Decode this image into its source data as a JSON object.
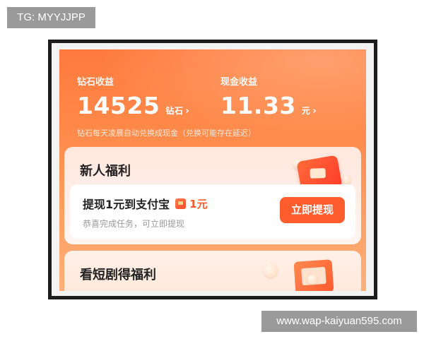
{
  "watermarks": {
    "top_left": "TG: MYYJJPP",
    "bottom_right": "www.wap-kaiyuan595.com"
  },
  "earnings": {
    "diamond": {
      "label": "钻石收益",
      "value": "14525",
      "unit": "钻石",
      "chevron": "›"
    },
    "cash": {
      "label": "现金收益",
      "value": "11.33",
      "unit": "元",
      "chevron": "›"
    },
    "note": "钻石每天凌晨自动兑换成现金（兑换可能存在延迟）"
  },
  "new_user_card": {
    "title": "新人福利",
    "task": {
      "title": "提现1元到支付宝",
      "amount": "1元",
      "subtitle": "恭喜完成任务，可立即提现",
      "button": "立即提现"
    }
  },
  "drama_card": {
    "title": "看短剧得福利"
  },
  "colors": {
    "header_orange": "#ff7a3d",
    "button_orange": "#ff5d2e",
    "amount_red": "#ff5a2a"
  },
  "icons": {
    "red_packet": "red-packet-icon",
    "gift": "gift-icon",
    "drama_ticket": "drama-ticket-icon"
  }
}
